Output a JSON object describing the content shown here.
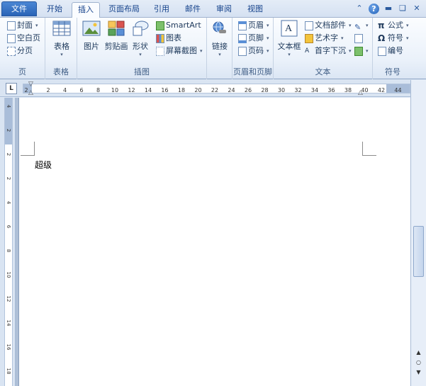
{
  "tabs": [
    "文件",
    "开始",
    "插入",
    "页面布局",
    "引用",
    "邮件",
    "审阅",
    "视图"
  ],
  "active_tab": "插入",
  "ribbon": {
    "pages": {
      "label": "页",
      "items": [
        "封面",
        "空白页",
        "分页"
      ]
    },
    "tables": {
      "label": "表格",
      "button": "表格"
    },
    "illustrations": {
      "label": "插图",
      "picture": "图片",
      "clipart": "剪贴画",
      "shapes": "形状",
      "smartart": "SmartArt",
      "chart": "图表",
      "screenshot": "屏幕截图"
    },
    "links": {
      "label": "",
      "button": "链接"
    },
    "header_footer": {
      "label": "页眉和页脚",
      "items": [
        "页眉",
        "页脚",
        "页码"
      ]
    },
    "text": {
      "label": "文本",
      "textbox": "文本框",
      "items": [
        "文档部件",
        "艺术字",
        "首字下沉"
      ]
    },
    "symbols": {
      "label": "符号",
      "items": [
        "公式",
        "符号",
        "编号"
      ],
      "pi": "π",
      "omega": "Ω"
    }
  },
  "ruler": {
    "tab_selector": "L",
    "h_ticks": [
      "2",
      "2",
      "4",
      "6",
      "8",
      "10",
      "12",
      "14",
      "16",
      "18",
      "20",
      "22",
      "24",
      "26",
      "28",
      "30",
      "32",
      "34",
      "36",
      "38",
      "40",
      "42",
      "44"
    ],
    "v_ticks": [
      "4",
      "2",
      "2",
      "2",
      "4",
      "6",
      "8",
      "10",
      "12",
      "14",
      "16",
      "18"
    ]
  },
  "document": {
    "text": "超级"
  },
  "colors": {
    "accent": "#2a64b7",
    "ribbon_bg": "#eaf1fa",
    "page_bg": "#ffffff"
  }
}
